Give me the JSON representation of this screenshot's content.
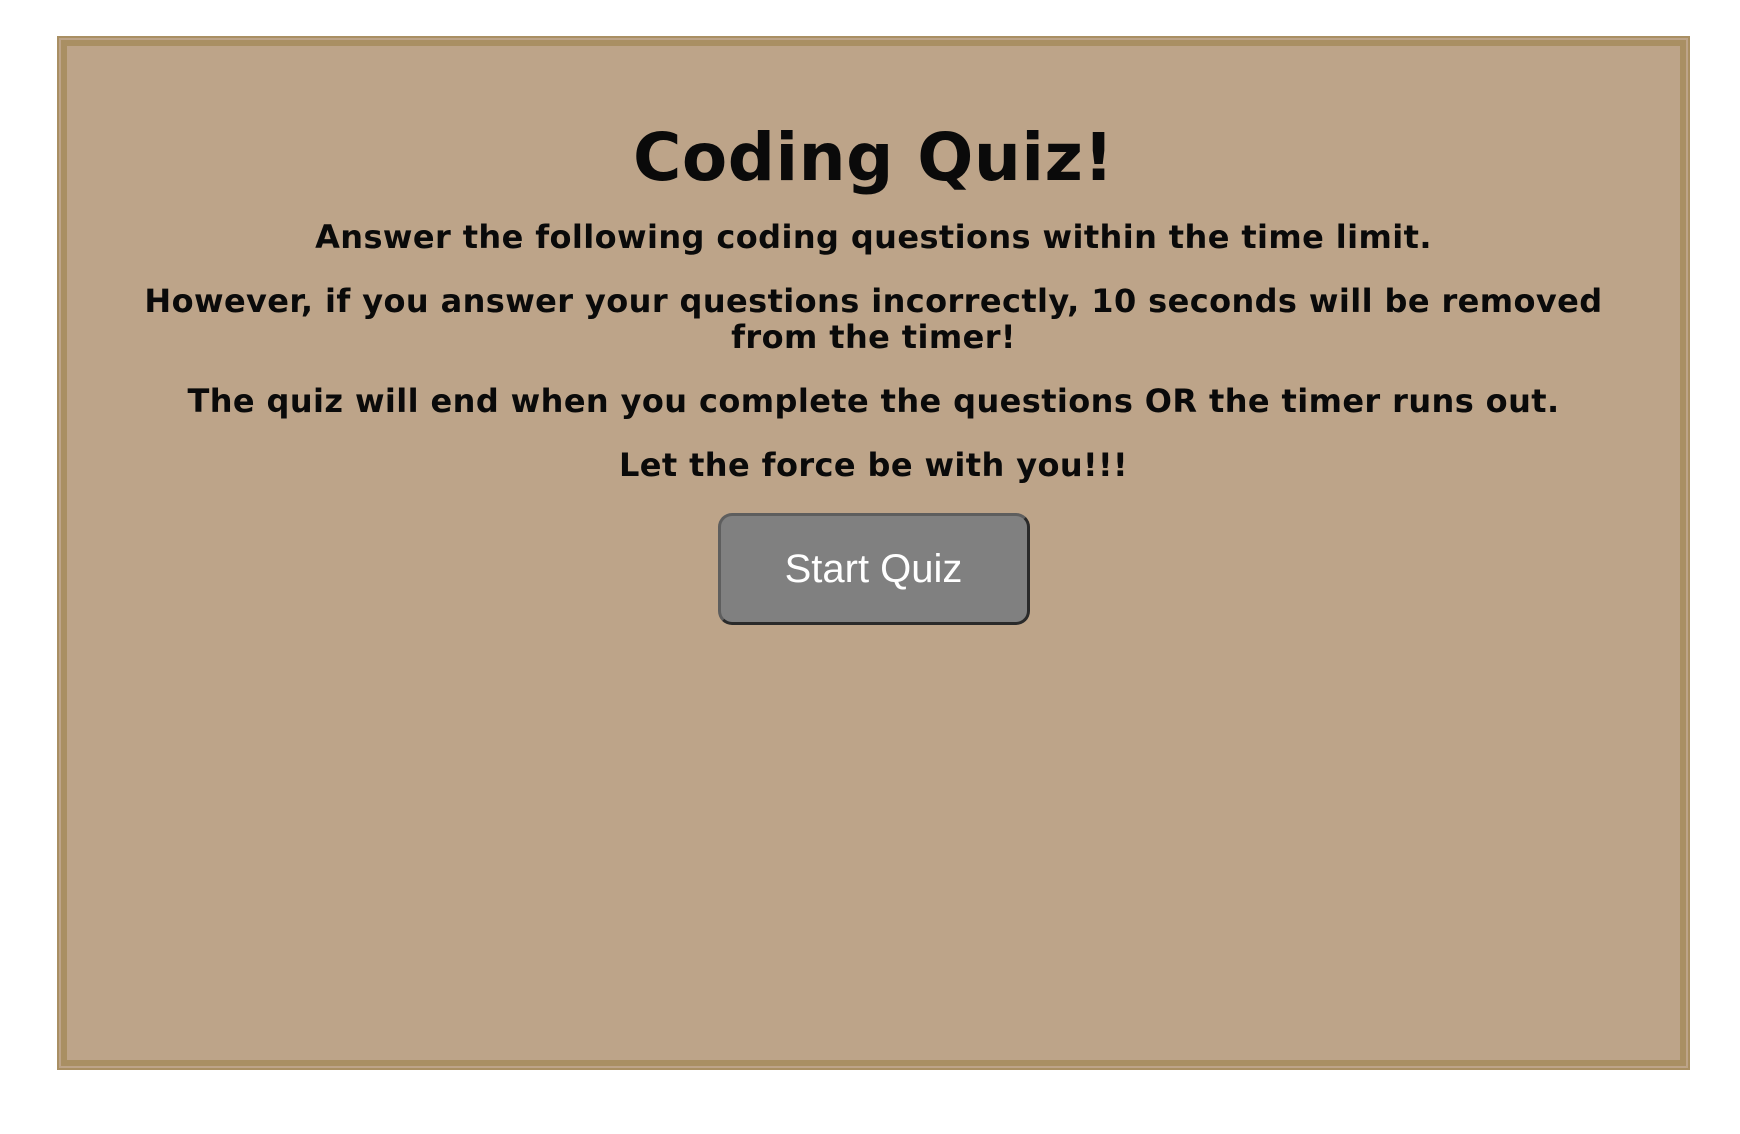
{
  "quiz": {
    "title": "Coding Quiz!",
    "instructions": [
      "Answer the following coding questions within the time limit.",
      "However, if you answer your questions incorrectly, 10 seconds will be removed from the timer!",
      "The quiz will end when you complete the questions OR the timer runs out.",
      "Let the force be with you!!!"
    ],
    "start_button_label": "Start Quiz"
  },
  "colors": {
    "page_background": "#ffffff",
    "panel_background": "#bda489",
    "panel_border": "#a98f63",
    "button_background": "#808080",
    "button_text": "#ffffff",
    "text": "#0a0a0a"
  }
}
